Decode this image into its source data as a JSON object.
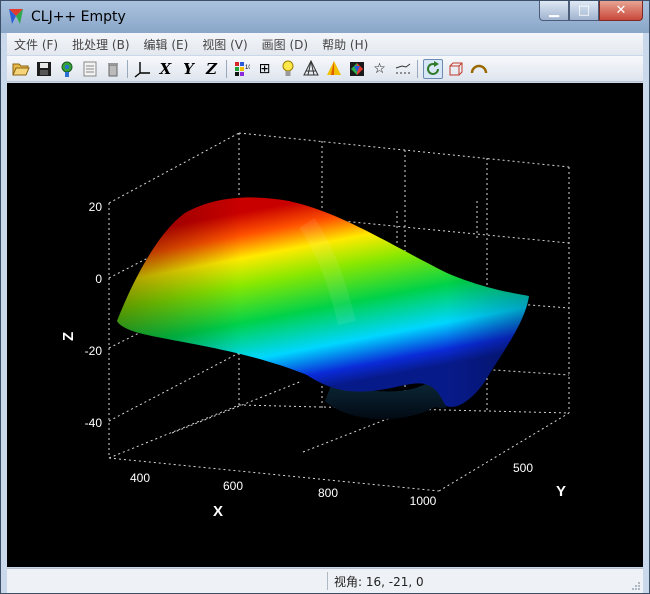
{
  "window": {
    "title": "CLJ++ Empty",
    "controls": {
      "minimize": "▁",
      "maximize": "□",
      "close": "✕"
    }
  },
  "menu": [
    {
      "label": "文件 (F)"
    },
    {
      "label": "批处理 (B)"
    },
    {
      "label": "编辑 (E)"
    },
    {
      "label": "视图 (V)"
    },
    {
      "label": "画图 (D)"
    },
    {
      "label": "帮助 (H)"
    }
  ],
  "toolbar": {
    "open_icon": "folder-open-icon",
    "save_icon": "save-icon",
    "colormap_icon": "colormap-icon",
    "text_glyph": "⊞",
    "axis_x": "X",
    "axis_y": "Y",
    "axis_z": "Z",
    "star_glyph": "☆",
    "rotate_selected": true
  },
  "plot": {
    "z_title": "Z",
    "x_title": "X",
    "y_title": "Y",
    "z_ticks": [
      "20",
      "0",
      "-20",
      "-40"
    ],
    "x_ticks": [
      "400",
      "600",
      "800",
      "1000"
    ],
    "y_ticks": [
      "500"
    ],
    "colormap": [
      "#0a2bd8",
      "#00d6ff",
      "#00d24a",
      "#8be800",
      "#ffea00",
      "#ff5200",
      "#c80000"
    ]
  },
  "status": {
    "view_angle": "视角: 16, -21, 0"
  }
}
